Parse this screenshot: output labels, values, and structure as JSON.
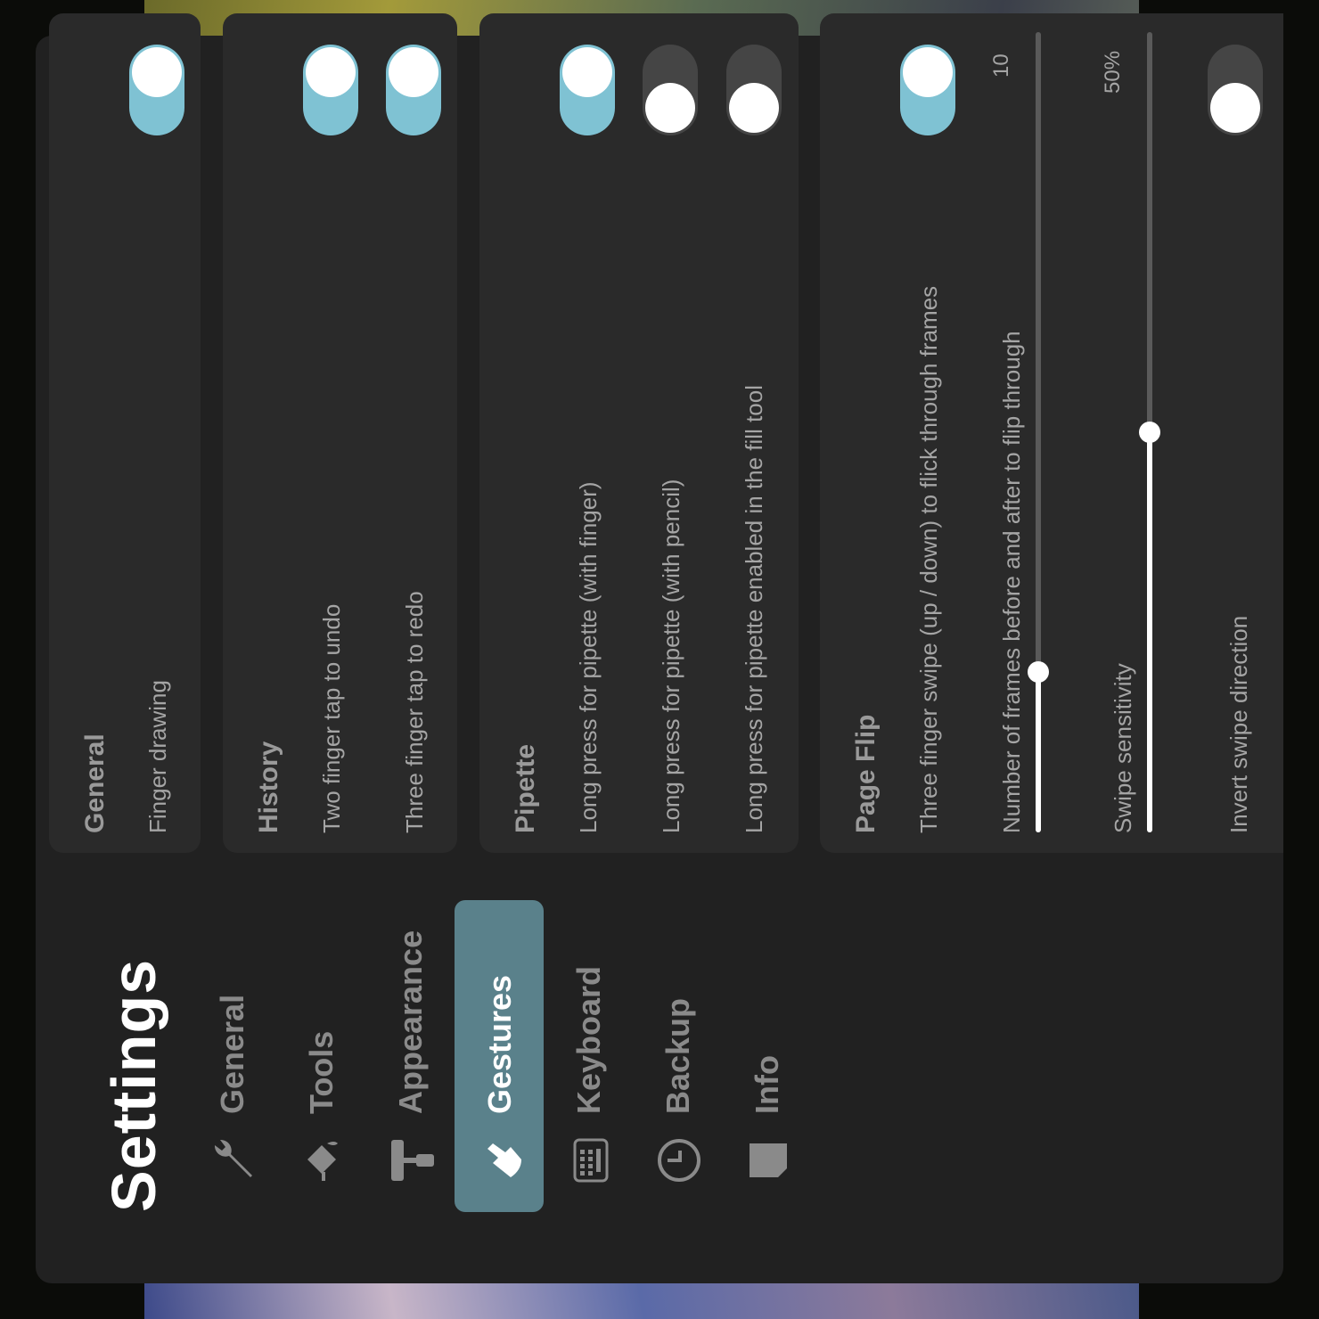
{
  "app": {
    "title": "Settings"
  },
  "nav": {
    "items": [
      {
        "label": "General",
        "icon": "wrench-icon",
        "active": false
      },
      {
        "label": "Tools",
        "icon": "paint-bucket-icon",
        "active": false
      },
      {
        "label": "Appearance",
        "icon": "paint-roller-icon",
        "active": false
      },
      {
        "label": "Gestures",
        "icon": "hand-pointer-icon",
        "active": true
      },
      {
        "label": "Keyboard",
        "icon": "keyboard-icon",
        "active": false
      },
      {
        "label": "Backup",
        "icon": "backup-clock-icon",
        "active": false
      },
      {
        "label": "Info",
        "icon": "info-document-icon",
        "active": false
      }
    ]
  },
  "sections": {
    "general": {
      "title": "General",
      "rows": [
        {
          "label": "Finger drawing",
          "on": true
        }
      ]
    },
    "history": {
      "title": "History",
      "rows": [
        {
          "label": "Two finger tap to undo",
          "on": true
        },
        {
          "label": "Three finger tap to redo",
          "on": true
        }
      ]
    },
    "pipette": {
      "title": "Pipette",
      "rows": [
        {
          "label": "Long press for pipette (with finger)",
          "on": true
        },
        {
          "label": "Long press for pipette (with pencil)",
          "on": false
        },
        {
          "label": "Long press for pipette enabled in the fill tool",
          "on": false
        }
      ]
    },
    "page_flip": {
      "title": "Page Flip",
      "swipe_row": {
        "label": "Three finger swipe (up / down) to flick through frames",
        "on": true
      },
      "frames_row": {
        "label": "Number of frames before and after to flip through",
        "value_text": "10",
        "fraction": 0.2
      },
      "sensitivity_row": {
        "label": "Swipe sensitivity",
        "value_text": "50%",
        "fraction": 0.5
      },
      "invert_row": {
        "label": "Invert swipe direction",
        "on": false
      }
    }
  },
  "colors": {
    "accent": "#7fc2d3",
    "nav_active": "#5a818b",
    "panel": "#212121",
    "card": "#2a2a2a"
  }
}
